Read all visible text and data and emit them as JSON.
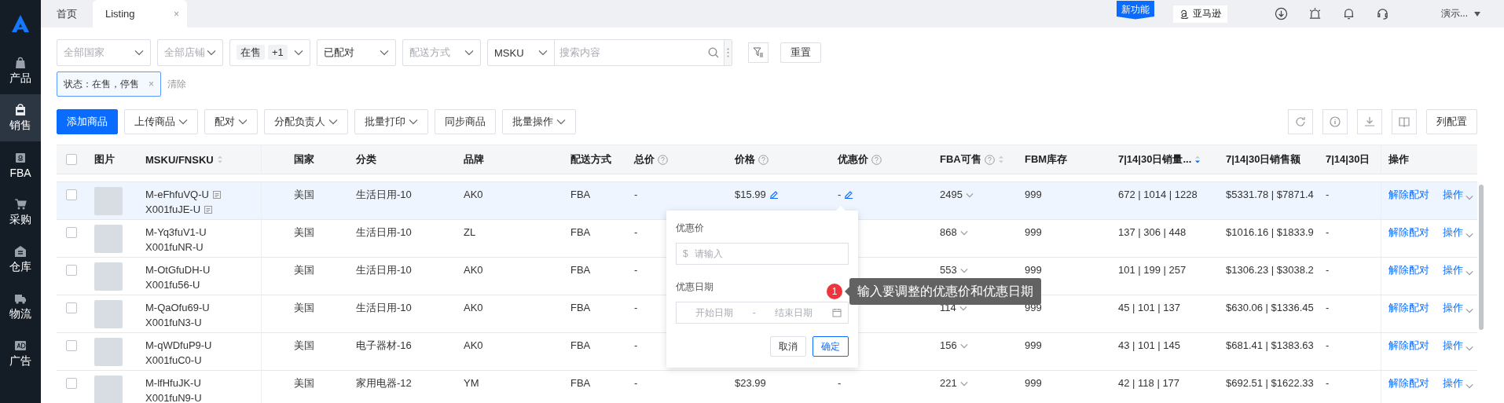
{
  "sidebar": {
    "items": [
      {
        "label": "产品",
        "selected": false
      },
      {
        "label": "销售",
        "selected": true
      },
      {
        "label": "FBA",
        "selected": false
      },
      {
        "label": "采购",
        "selected": false
      },
      {
        "label": "仓库",
        "selected": false
      },
      {
        "label": "物流",
        "selected": false
      },
      {
        "label": "广告",
        "selected": false
      }
    ]
  },
  "tabs": [
    {
      "label": "首页",
      "selected": false
    },
    {
      "label": "Listing",
      "selected": true,
      "close": "×"
    }
  ],
  "header": {
    "new_feature": "新功能",
    "marketplace": "亚马逊",
    "user": "演示..."
  },
  "filters": [
    {
      "kind": "select",
      "placeholder": "全部国家"
    },
    {
      "kind": "select",
      "placeholder": "全部店铺"
    },
    {
      "kind": "multi",
      "chips": [
        "在售",
        "+1"
      ]
    },
    {
      "kind": "select",
      "value": "已配对"
    },
    {
      "kind": "select",
      "placeholder": "配送方式"
    }
  ],
  "search": {
    "field": "MSKU",
    "placeholder": "搜索内容"
  },
  "reset_button": "重置",
  "active_filter": {
    "label": "状态：在售，停售",
    "remove": "×",
    "clear": "清除"
  },
  "toolbar": {
    "buttons": [
      {
        "label": "添加商品",
        "kind": "primary",
        "dropdown": false
      },
      {
        "label": "上传商品",
        "kind": "default",
        "dropdown": true
      },
      {
        "label": "配对",
        "kind": "default",
        "dropdown": true
      },
      {
        "label": "分配负责人",
        "kind": "default",
        "dropdown": true
      },
      {
        "label": "批量打印",
        "kind": "default",
        "dropdown": true
      },
      {
        "label": "同步商品",
        "kind": "default",
        "dropdown": false
      },
      {
        "label": "批量操作",
        "kind": "default",
        "dropdown": true
      }
    ],
    "column_settings": "列配置"
  },
  "table": {
    "select_all": {
      "checked": false
    },
    "columns": [
      {
        "label": "图片"
      },
      {
        "label": "MSKU/FNSKU",
        "sortable": true,
        "sorted_descending": false
      },
      {
        "label": "国家"
      },
      {
        "label": "分类"
      },
      {
        "label": "品牌"
      },
      {
        "label": "配送方式"
      },
      {
        "label": "总价",
        "help": true
      },
      {
        "label": "价格",
        "help": true
      },
      {
        "label": "优惠价",
        "help": true
      },
      {
        "label": "FBA可售",
        "help": true,
        "sortable": true,
        "sorted_descending": false
      },
      {
        "label": "FBM库存"
      },
      {
        "label": "7|14|30日销量...",
        "sortable": true,
        "sorted_descending": true
      },
      {
        "label": "7|14|30日销售额"
      },
      {
        "label": "7|14|30日"
      },
      {
        "label": "操作"
      }
    ],
    "rows": [
      {
        "checked": false,
        "hovered": true,
        "msku": "M-eFhfuVQ-U",
        "fnsku": "X001fuJE-U",
        "country": "美国",
        "category": "生活日用-10",
        "brand": "AK0",
        "shipping": "FBA",
        "total": "-",
        "price": "$15.99",
        "price_editable": true,
        "discount": "-",
        "discount_editable": true,
        "fba": "2495",
        "fbm": "999",
        "units": "672 | 1014 | 1228",
        "sales": "$5331.78 | $7871.4",
        "column_14": "-",
        "actions": [
          "解除配对",
          "操作"
        ]
      },
      {
        "checked": false,
        "hovered": false,
        "msku": "M-Yq3fuV1-U",
        "fnsku": "X001fuNR-U",
        "country": "美国",
        "category": "生活日用-10",
        "brand": "ZL",
        "shipping": "FBA",
        "total": "-",
        "fba": "868",
        "fbm": "999",
        "units": "137 | 306 | 448",
        "sales": "$1016.16 | $1833.9",
        "column_14": "-",
        "actions": [
          "解除配对",
          "操作"
        ]
      },
      {
        "checked": false,
        "hovered": false,
        "msku": "M-OtGfuDH-U",
        "fnsku": "X001fu56-U",
        "country": "美国",
        "category": "生活日用-10",
        "brand": "AK0",
        "shipping": "FBA",
        "total": "-",
        "fba": "553",
        "fbm": "999",
        "units": "101 | 199 | 257",
        "sales": "$1306.23 | $3038.2",
        "column_14": "-",
        "actions": [
          "解除配对",
          "操作"
        ]
      },
      {
        "checked": false,
        "hovered": false,
        "msku": "M-QaOfu69-U",
        "fnsku": "X001fuN3-U",
        "country": "美国",
        "category": "生活日用-10",
        "brand": "AK0",
        "shipping": "FBA",
        "total": "-",
        "fba": "114",
        "fbm": "999",
        "units": "45 | 101 | 137",
        "sales": "$630.06 | $1336.45",
        "column_14": "-",
        "actions": [
          "解除配对",
          "操作"
        ]
      },
      {
        "checked": false,
        "hovered": false,
        "msku": "M-qWDfuP9-U",
        "fnsku": "X001fuC0-U",
        "country": "美国",
        "category": "电子器材-16",
        "brand": "AK0",
        "shipping": "FBA",
        "total": "-",
        "fba": "156",
        "fbm": "999",
        "units": "43 | 101 | 145",
        "sales": "$681.41 | $1383.63",
        "column_14": "-",
        "actions": [
          "解除配对",
          "操作"
        ]
      },
      {
        "checked": false,
        "hovered": false,
        "msku": "M-lfHfuJK-U",
        "fnsku": "X001fuN9-U",
        "country": "美国",
        "category": "家用电器-12",
        "brand": "YM",
        "shipping": "FBA",
        "total": "-",
        "price": "$23.99",
        "price_editable": false,
        "discount": "-",
        "discount_editable": false,
        "fba": "221",
        "fbm": "999",
        "units": "42 | 118 | 177",
        "sales": "$692.51 | $1622.33",
        "column_14": "-",
        "actions": [
          "解除配对",
          "操作"
        ]
      }
    ]
  },
  "popover": {
    "price_label": "优惠价",
    "currency": "$",
    "price_placeholder": "请输入",
    "date_label": "优惠日期",
    "start_placeholder": "开始日期",
    "separator": "-",
    "end_placeholder": "结束日期",
    "cancel": "取消",
    "confirm": "确定"
  },
  "tooltip": {
    "badge": "1",
    "text": "输入要调整的优惠价和优惠日期"
  }
}
